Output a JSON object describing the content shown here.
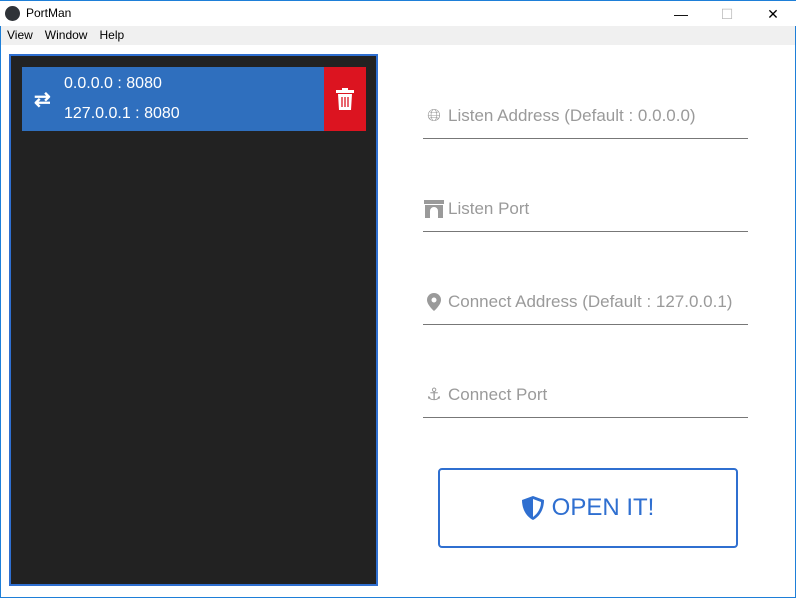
{
  "window": {
    "title": "PortMan",
    "minimize": "—",
    "maximize": "☐",
    "close": "✕"
  },
  "menu": [
    "View",
    "Window",
    "Help"
  ],
  "rules": [
    {
      "listen": "0.0.0.0 : 8080",
      "connect": "127.0.0.1 : 8080"
    }
  ],
  "form": {
    "listen_address": "Listen Address (Default : 0.0.0.0)",
    "listen_port": "Listen Port",
    "connect_address": "Connect Address (Default : 127.0.0.1)",
    "connect_port": "Connect Port",
    "submit": "OPEN IT!"
  },
  "colors": {
    "accent": "#2f6fbe",
    "delete": "#dc1420",
    "list_bg": "#222222"
  }
}
